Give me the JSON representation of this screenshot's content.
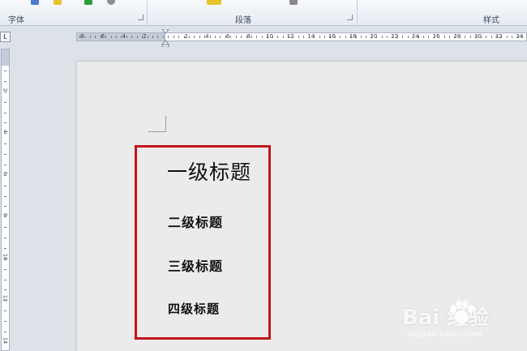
{
  "ribbon": {
    "groups": [
      {
        "label": "字体"
      },
      {
        "label": "段落"
      },
      {
        "label": "样式"
      }
    ],
    "icon_colors": [
      "#4a7bd1",
      "#e7c52a",
      "#2c9c3e",
      "#6b6b6b",
      "#e7c52a",
      "#8a8a8a",
      "#6b6b6b"
    ]
  },
  "ruler": {
    "toggle_label": "L",
    "left_ticks": [
      "8",
      "6",
      "4",
      "2"
    ],
    "right_ticks": [
      "2",
      "4",
      "6",
      "8",
      "10",
      "12",
      "14",
      "16",
      "18",
      "20",
      "22",
      "24",
      "26",
      "28",
      "30",
      "32",
      "34"
    ],
    "vertical_ticks": [
      "2",
      "4",
      "6",
      "8",
      "10",
      "12",
      "14"
    ]
  },
  "document": {
    "headings": {
      "level1": "一级标题",
      "level2": "二级标题",
      "level3": "三级标题",
      "level4": "四级标题"
    },
    "highlight_color": "#c3151b"
  },
  "watermark": {
    "brand": "Bai  经验",
    "url": "jingyan.baidu.com"
  }
}
